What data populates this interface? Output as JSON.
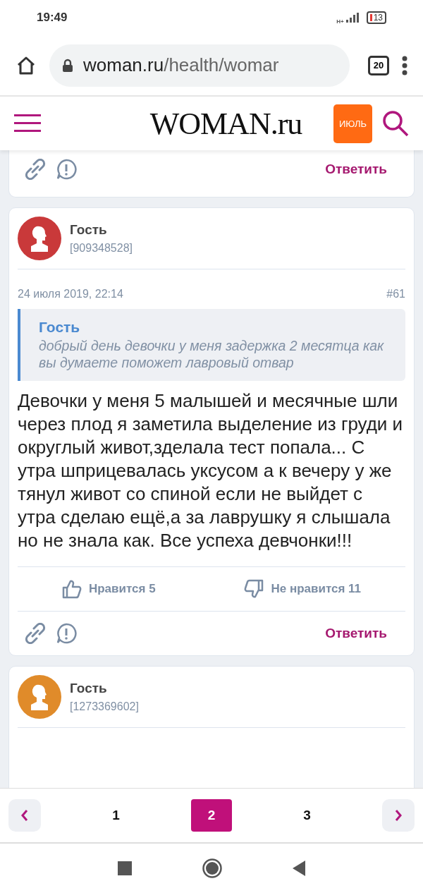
{
  "status_bar": {
    "time": "19:49",
    "network": "H+",
    "battery": "13"
  },
  "browser": {
    "url_host": "woman.ru",
    "url_path": "/health/womar",
    "tabs_count": "20"
  },
  "site_header": {
    "logo": "WOMAN.ru",
    "badge": "ИЮЛЬ"
  },
  "prev_post": {
    "reply": "Ответить"
  },
  "post": {
    "author": "Гость",
    "author_id": "[909348528]",
    "color": "#c9393a",
    "date": "24 июля 2019, 22:14",
    "number": "#61",
    "quote": {
      "author": "Гость",
      "text": "добрый день девочки у меня задержка 2 месятца как вы думаете поможет лавровый отвар"
    },
    "text": "Девочки у меня 5 малышей и месячные шли через плод я заметила выделение из груди и округлый живот,зделала тест попала... С утра шприцевалась уксусом а к вечеру у же тянул живот со спиной если не выйдет с утра сделаю ещё,а за лаврушку я слышала но не знала как. Все успеха девчонки!!!",
    "like": "Нравится 5",
    "dislike": "Не нравится 11",
    "reply": "Ответить"
  },
  "next_post": {
    "author": "Гость",
    "author_id": "[1273369602]",
    "color": "#e08b2a"
  },
  "pagination": {
    "pages": [
      {
        "label": "1",
        "selected": false
      },
      {
        "label": "2",
        "selected": true
      },
      {
        "label": "3",
        "selected": false
      }
    ]
  }
}
